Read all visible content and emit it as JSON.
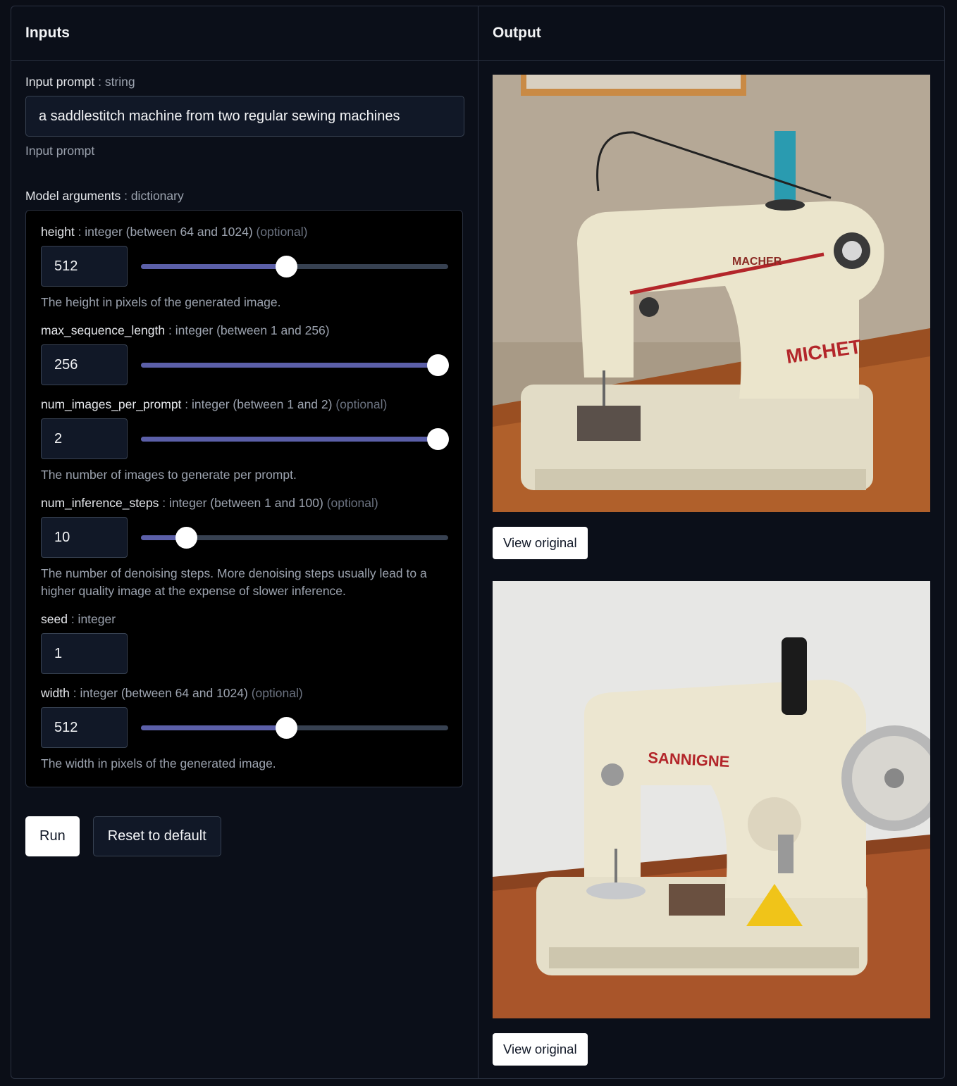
{
  "inputs": {
    "title": "Inputs",
    "prompt": {
      "label": "Input prompt",
      "type": ": string",
      "value": "a saddlestitch machine from two regular sewing machines",
      "help": "Input prompt"
    },
    "model_args": {
      "label": "Model arguments",
      "type": ": dictionary",
      "args": [
        {
          "name": "height",
          "type": ": integer (between 64 and 1024)",
          "optional": "(optional)",
          "value": "512",
          "slider_fraction": 0.47,
          "description": "The height in pixels of the generated image."
        },
        {
          "name": "max_sequence_length",
          "type": ": integer (between 1 and 256)",
          "optional": "",
          "value": "256",
          "slider_fraction": 1.0,
          "description": ""
        },
        {
          "name": "num_images_per_prompt",
          "type": ": integer (between 1 and 2)",
          "optional": "(optional)",
          "value": "2",
          "slider_fraction": 1.0,
          "description": "The number of images to generate per prompt."
        },
        {
          "name": "num_inference_steps",
          "type": ": integer (between 1 and 100)",
          "optional": "(optional)",
          "value": "10",
          "slider_fraction": 0.12,
          "description": "The number of denoising steps. More denoising steps usually lead to a higher quality image at the expense of slower inference."
        },
        {
          "name": "seed",
          "type": ": integer",
          "optional": "",
          "value": "1",
          "slider_fraction": null,
          "description": ""
        },
        {
          "name": "width",
          "type": ": integer (between 64 and 1024)",
          "optional": "(optional)",
          "value": "512",
          "slider_fraction": 0.47,
          "description": "The width in pixels of the generated image."
        }
      ]
    },
    "run_label": "Run",
    "reset_label": "Reset to default"
  },
  "output": {
    "title": "Output",
    "images": [
      {
        "brand": "MICHET",
        "brand2": "MACHER",
        "view_label": "View original"
      },
      {
        "brand": "SANNIGNE",
        "view_label": "View original"
      }
    ]
  },
  "colors": {
    "accent": "#5b5fa8",
    "background": "#0b0f19"
  }
}
